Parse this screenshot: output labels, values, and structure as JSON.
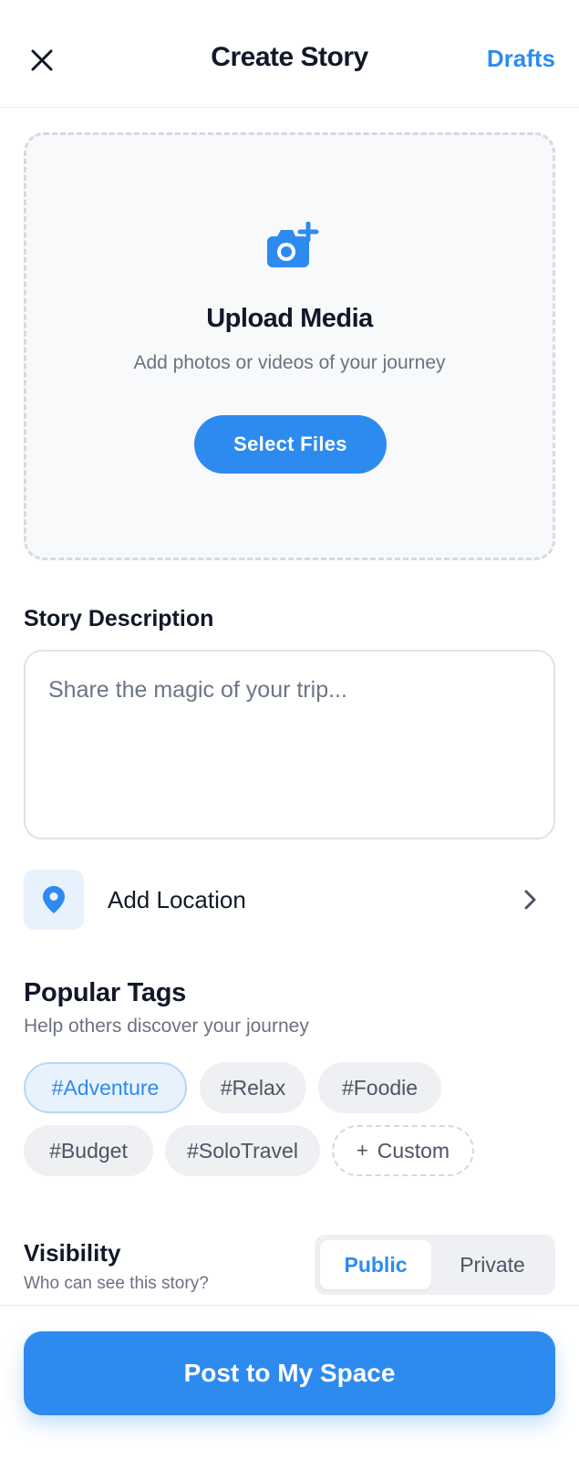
{
  "header": {
    "title": "Create Story",
    "drafts_label": "Drafts",
    "close_icon": "close-icon"
  },
  "upload": {
    "icon": "camera-plus-icon",
    "title": "Upload Media",
    "subtitle": "Add photos or videos of your journey",
    "button_label": "Select Files"
  },
  "description": {
    "label": "Story Description",
    "placeholder": "Share the magic of your trip...",
    "value": ""
  },
  "location": {
    "icon": "map-pin-icon",
    "label": "Add Location",
    "chevron_icon": "chevron-right-icon"
  },
  "tags": {
    "title": "Popular Tags",
    "subtitle": "Help others discover your journey",
    "items": [
      {
        "label": "#Adventure",
        "selected": true
      },
      {
        "label": "#Relax",
        "selected": false
      },
      {
        "label": "#Foodie",
        "selected": false
      },
      {
        "label": "#Budget",
        "selected": false
      },
      {
        "label": "#SoloTravel",
        "selected": false
      }
    ],
    "custom_label": "Custom"
  },
  "visibility": {
    "title": "Visibility",
    "subtitle": "Who can see this story?",
    "options": [
      "Public",
      "Private"
    ],
    "selected": "Public"
  },
  "footer": {
    "post_label": "Post to My Space"
  },
  "colors": {
    "accent": "#2d8bef",
    "accent_light": "#e8f2fd",
    "muted_text": "#6b7280"
  }
}
